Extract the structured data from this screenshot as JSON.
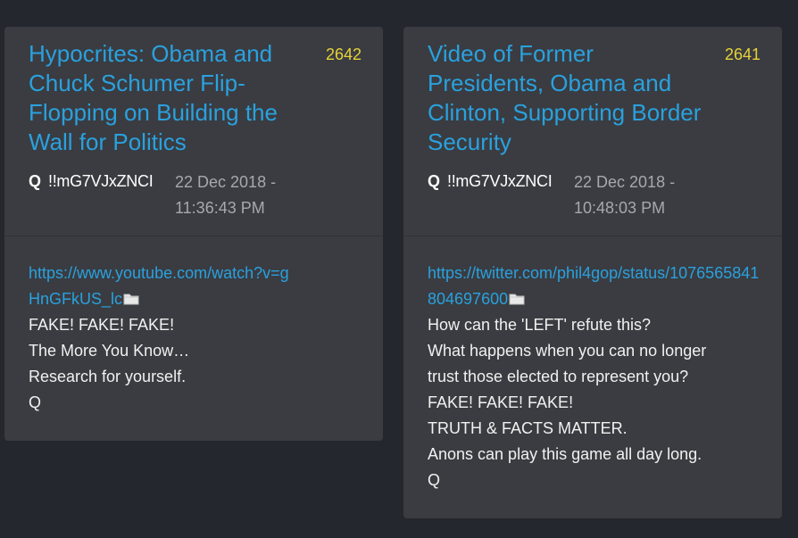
{
  "posts": [
    {
      "title": "Hypocrites: Obama and Chuck Schumer Flip-Flopping on Building the Wall for Politics",
      "number": "2642",
      "author": "Q",
      "tripcode": "!!mG7VJxZNCI",
      "date": "22 Dec 2018 - 11:36:43 PM",
      "link": "https://www.youtube.com/watch?v=gHnGFkUS_lc",
      "icon": "folder-icon",
      "lines": [
        "FAKE! FAKE! FAKE!",
        "The More You Know…",
        "Research for yourself.",
        "Q"
      ]
    },
    {
      "title": "Video of Former Presidents, Obama and Clinton, Supporting Border Security",
      "number": "2641",
      "author": "Q",
      "tripcode": "!!mG7VJxZNCI",
      "date": "22 Dec 2018 - 10:48:03 PM",
      "link": "https://twitter.com/phil4gop/status/1076565841804697600",
      "icon": "folder-icon",
      "lines": [
        "How can the 'LEFT' refute this?",
        "What happens when you can no longer",
        "trust those elected to represent you?",
        "FAKE! FAKE! FAKE!",
        "TRUTH & FACTS MATTER.",
        "Anons can play this game all day long.",
        "Q"
      ]
    }
  ],
  "colors": {
    "background": "#24272d",
    "card": "#3a3c41",
    "link": "#2aa1de",
    "post_number": "#e6d238"
  }
}
